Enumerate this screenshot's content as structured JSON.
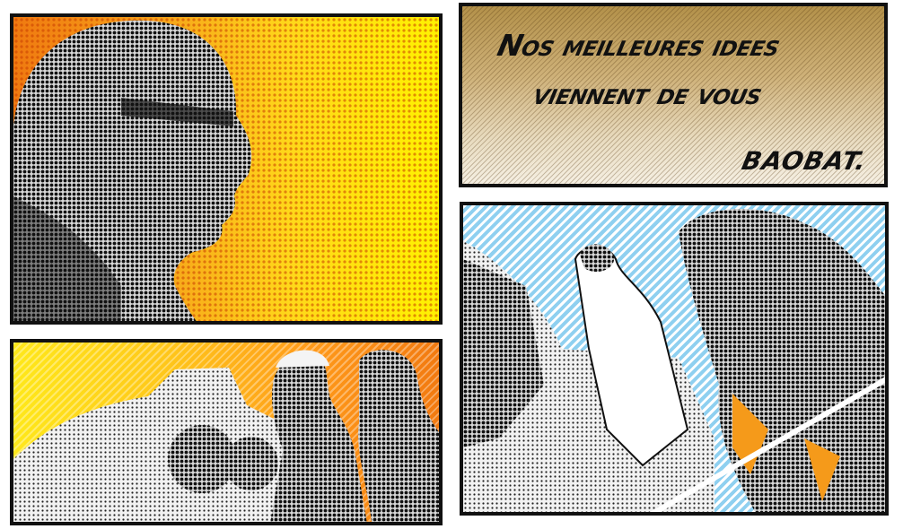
{
  "caption": {
    "line1": "Nos meilleures idees",
    "line2": "viennent de vous",
    "brand": "baobat."
  },
  "colors": {
    "panel_border": "#111111",
    "orange": "#f07a10",
    "yellow": "#fff200",
    "tan": "#b3914a",
    "sky_blue": "#8fd0f0"
  }
}
